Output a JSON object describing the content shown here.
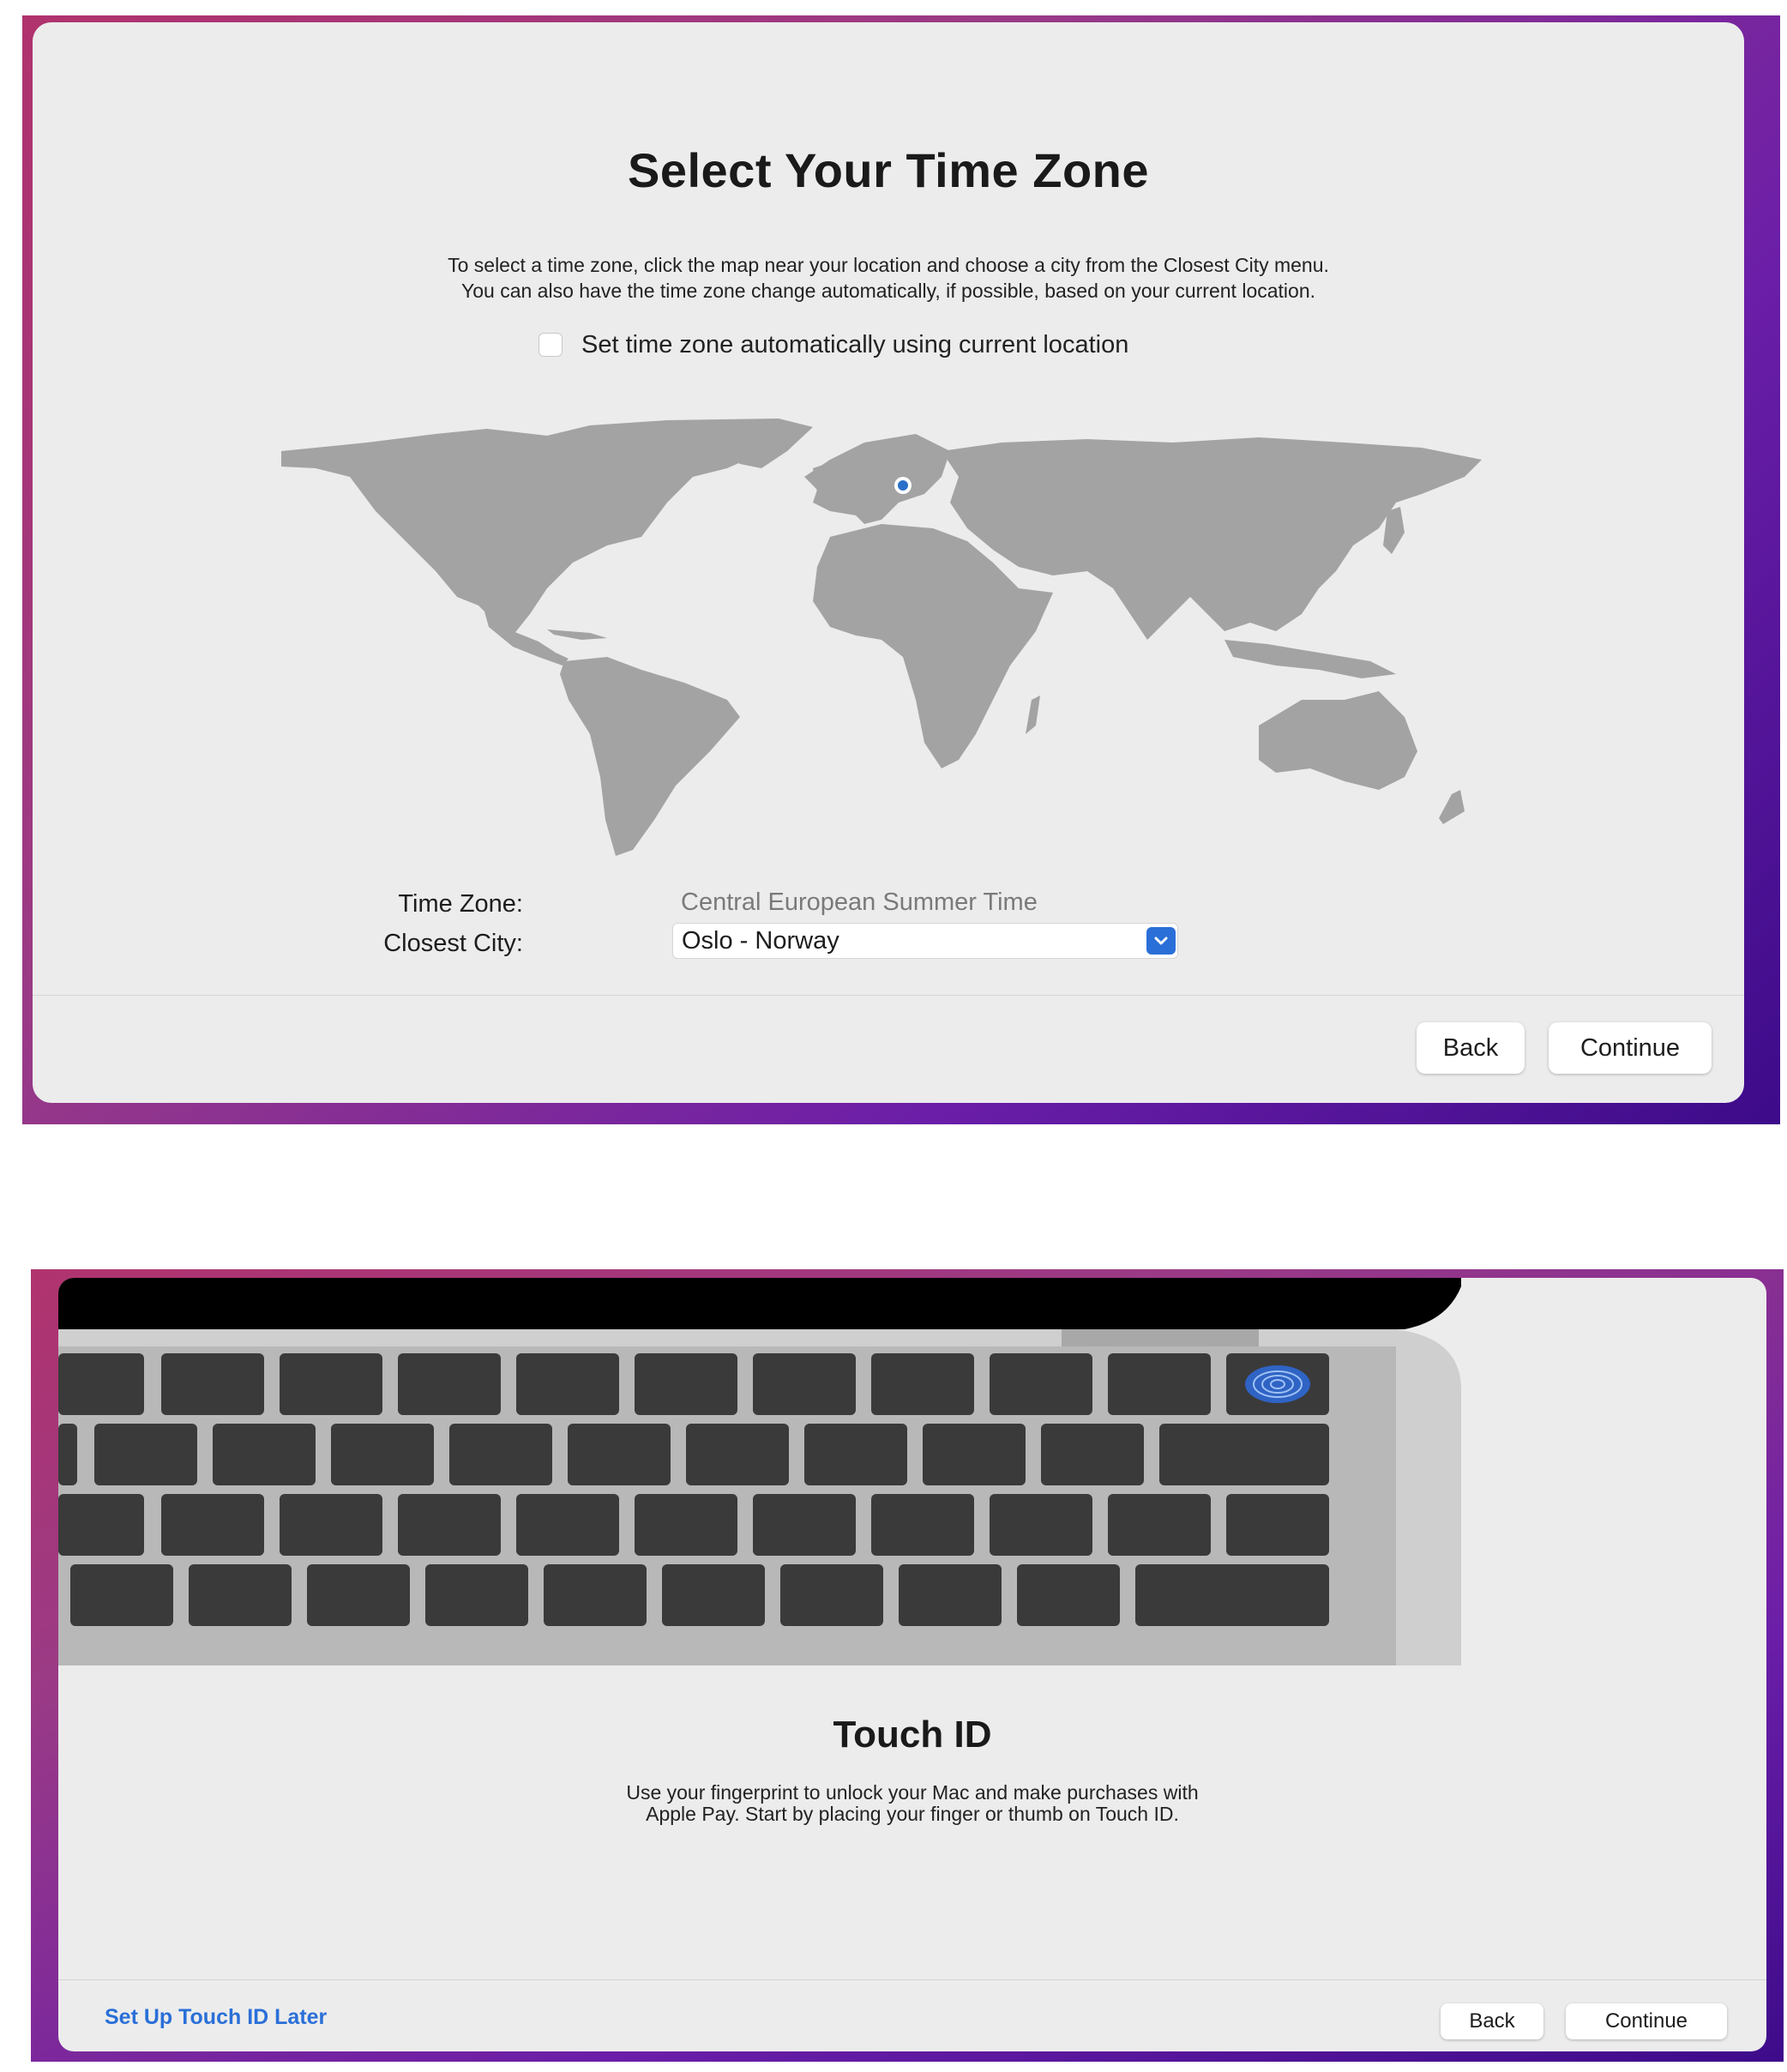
{
  "timezone_screen": {
    "title": "Select Your Time Zone",
    "description_line1": "To select a time zone, click the map near your location and choose a city from the Closest City menu.",
    "description_line2": "You can also have the time zone change automatically, if possible, based on your current location.",
    "auto_checkbox_label": "Set time zone automatically using current location",
    "auto_checkbox_checked": false,
    "time_zone_label": "Time Zone:",
    "time_zone_value": "Central European Summer Time",
    "closest_city_label": "Closest City:",
    "closest_city_value": "Oslo - Norway",
    "back_label": "Back",
    "continue_label": "Continue",
    "selected_pin_color": "#2a70c9"
  },
  "touchid_screen": {
    "title": "Touch ID",
    "description_line1": "Use your fingerprint to unlock your Mac and make purchases with",
    "description_line2": "Apple Pay. Start by placing your finger or thumb on Touch ID.",
    "later_link_label": "Set Up Touch ID Later",
    "back_label": "Back",
    "continue_label": "Continue",
    "touch_id_key_color": "#2f63c4",
    "link_color": "#2a6fd8"
  },
  "icons": {
    "dropdown": "chevron-down-icon",
    "fingerprint": "fingerprint-icon",
    "location_pin": "location-pin-icon"
  }
}
